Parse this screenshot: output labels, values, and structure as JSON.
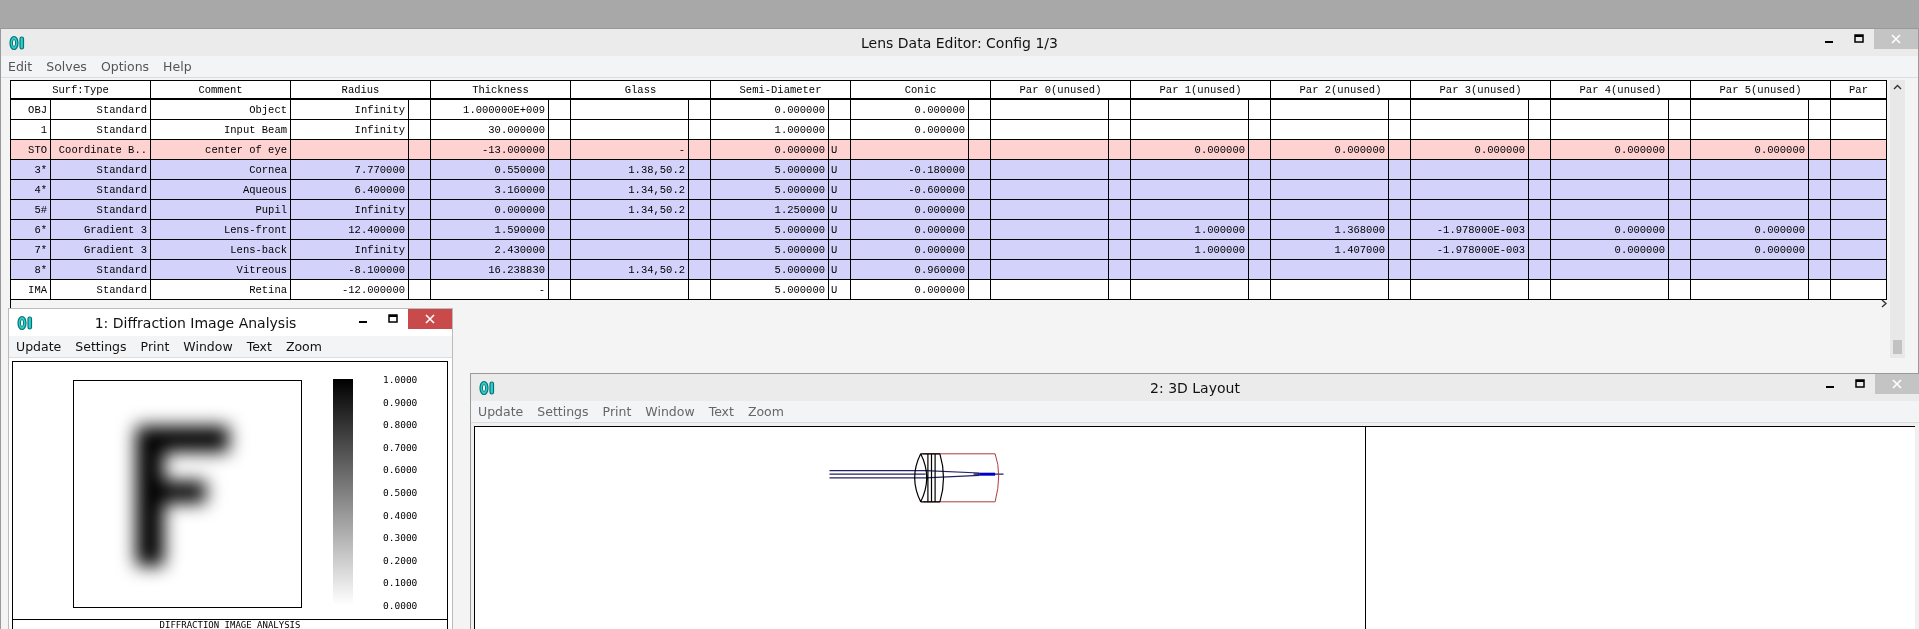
{
  "editor": {
    "title": "Lens Data Editor: Config 1/3",
    "menu": [
      "Edit",
      "Solves",
      "Options",
      "Help"
    ],
    "columns": [
      "Surf:Type",
      "Comment",
      "Radius",
      "Thickness",
      "Glass",
      "Semi-Diameter",
      "Conic",
      "Par 0(unused)",
      "Par 1(unused)",
      "Par 2(unused)",
      "Par 3(unused)",
      "Par 4(unused)",
      "Par 5(unused)",
      "Par"
    ],
    "rows": [
      {
        "color": "#ffffff",
        "cells": [
          {
            "surf": "OBJ",
            "type": "Standard"
          },
          {
            "value": "Object"
          },
          {
            "value": "Infinity"
          },
          {
            "value": "1.000000E+009"
          },
          {},
          {
            "value": "0.000000"
          },
          {
            "value": "0.000000"
          },
          {},
          {},
          {},
          {},
          {},
          {},
          {}
        ]
      },
      {
        "color": "#ffffff",
        "cells": [
          {
            "surf": "1",
            "type": "Standard"
          },
          {
            "value": "Input Beam"
          },
          {
            "value": "Infinity"
          },
          {
            "value": "30.000000"
          },
          {},
          {
            "value": "1.000000"
          },
          {
            "value": "0.000000"
          },
          {},
          {},
          {},
          {},
          {},
          {},
          {}
        ]
      },
      {
        "color": "#ffd2d2",
        "cells": [
          {
            "surf": "STO",
            "type": "Coordinate B.."
          },
          {
            "value": "center of eye"
          },
          {},
          {
            "value": "-13.000000"
          },
          {
            "value": "-"
          },
          {
            "value": "0.000000",
            "solve": "U"
          },
          {},
          {},
          {
            "value": "0.000000"
          },
          {
            "value": "0.000000"
          },
          {
            "value": "0.000000"
          },
          {
            "value": "0.000000"
          },
          {
            "value": "0.000000"
          },
          {}
        ]
      },
      {
        "color": "#d2d2fa",
        "cells": [
          {
            "surf": "3*",
            "type": "Standard"
          },
          {
            "value": "Cornea"
          },
          {
            "value": "7.770000"
          },
          {
            "value": "0.550000"
          },
          {
            "value": "1.38,50.2"
          },
          {
            "value": "5.000000",
            "solve": "U"
          },
          {
            "value": "-0.180000"
          },
          {},
          {},
          {},
          {},
          {},
          {},
          {}
        ]
      },
      {
        "color": "#d2d2fa",
        "cells": [
          {
            "surf": "4*",
            "type": "Standard"
          },
          {
            "value": "Aqueous"
          },
          {
            "value": "6.400000"
          },
          {
            "value": "3.160000"
          },
          {
            "value": "1.34,50.2"
          },
          {
            "value": "5.000000",
            "solve": "U"
          },
          {
            "value": "-0.600000"
          },
          {},
          {},
          {},
          {},
          {},
          {},
          {}
        ]
      },
      {
        "color": "#d2d2fa",
        "cells": [
          {
            "surf": "5#",
            "type": "Standard"
          },
          {
            "value": "Pupil"
          },
          {
            "value": "Infinity"
          },
          {
            "value": "0.000000"
          },
          {
            "value": "1.34,50.2"
          },
          {
            "value": "1.250000",
            "solve": "U"
          },
          {
            "value": "0.000000"
          },
          {},
          {},
          {},
          {},
          {},
          {},
          {}
        ]
      },
      {
        "color": "#d2d2fa",
        "cells": [
          {
            "surf": "6*",
            "type": "Gradient 3"
          },
          {
            "value": "Lens-front"
          },
          {
            "value": "12.400000"
          },
          {
            "value": "1.590000"
          },
          {},
          {
            "value": "5.000000",
            "solve": "U"
          },
          {
            "value": "0.000000"
          },
          {},
          {
            "value": "1.000000"
          },
          {
            "value": "1.368000"
          },
          {
            "value": "-1.978000E-003"
          },
          {
            "value": "0.000000"
          },
          {
            "value": "0.000000"
          },
          {}
        ]
      },
      {
        "color": "#d2d2fa",
        "cells": [
          {
            "surf": "7*",
            "type": "Gradient 3"
          },
          {
            "value": "Lens-back"
          },
          {
            "value": "Infinity"
          },
          {
            "value": "2.430000"
          },
          {},
          {
            "value": "5.000000",
            "solve": "U"
          },
          {
            "value": "0.000000"
          },
          {},
          {
            "value": "1.000000"
          },
          {
            "value": "1.407000"
          },
          {
            "value": "-1.978000E-003"
          },
          {
            "value": "0.000000"
          },
          {
            "value": "0.000000"
          },
          {}
        ]
      },
      {
        "color": "#d2d2fa",
        "cells": [
          {
            "surf": "8*",
            "type": "Standard"
          },
          {
            "value": "Vitreous"
          },
          {
            "value": "-8.100000"
          },
          {
            "value": "16.238830"
          },
          {
            "value": "1.34,50.2"
          },
          {
            "value": "5.000000",
            "solve": "U"
          },
          {
            "value": "0.960000"
          },
          {},
          {},
          {},
          {},
          {},
          {},
          {}
        ]
      },
      {
        "color": "#ffffff",
        "cells": [
          {
            "surf": "IMA",
            "type": "Standard"
          },
          {
            "value": "Retina"
          },
          {
            "value": "-12.000000"
          },
          {
            "value": "-"
          },
          {},
          {
            "value": "5.000000",
            "solve": "U"
          },
          {
            "value": "0.000000"
          },
          {},
          {},
          {},
          {},
          {},
          {},
          {}
        ]
      }
    ]
  },
  "diffraction_window": {
    "title": "1: Diffraction Image Analysis",
    "menu": [
      "Update",
      "Settings",
      "Print",
      "Window",
      "Text",
      "Zoom"
    ],
    "scale_labels": [
      "1.0000",
      "0.9000",
      "0.8000",
      "0.7000",
      "0.6000",
      "0.5000",
      "0.4000",
      "0.3000",
      "0.2000",
      "0.1000",
      "0.0000"
    ],
    "caption": "DIFFRACTION IMAGE ANALYSIS"
  },
  "layout_window": {
    "title": "2: 3D Layout",
    "menu": [
      "Update",
      "Settings",
      "Print",
      "Window",
      "Text",
      "Zoom"
    ]
  }
}
